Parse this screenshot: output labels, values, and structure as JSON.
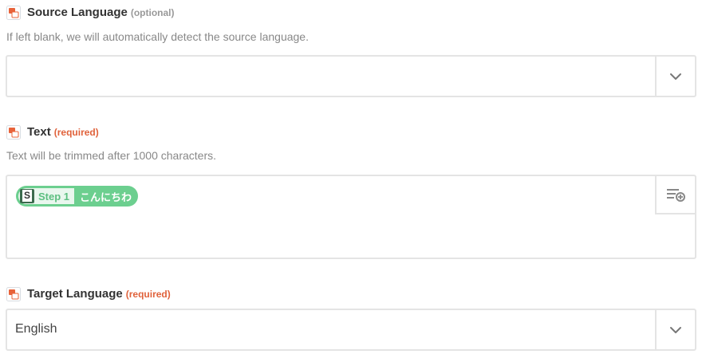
{
  "fields": {
    "source_language": {
      "label": "Source Language",
      "tag": "(optional)",
      "help": "If left blank, we will automatically detect the source language.",
      "value": ""
    },
    "text": {
      "label": "Text",
      "tag": "(required)",
      "help": "Text will be trimmed after 1000 characters.",
      "token": {
        "step_label": "Step 1",
        "value": "こんにちわ"
      }
    },
    "target_language": {
      "label": "Target Language",
      "tag": "(required)",
      "value": "English"
    }
  },
  "icons": {
    "field": "translate-app-icon",
    "dropdown": "chevron-down-icon",
    "insert": "insert-field-icon",
    "step": "s-app-icon"
  },
  "colors": {
    "required": "#e0623b",
    "optional": "#999999",
    "token_bg": "#6ccf8f",
    "border": "#e4e4e4"
  }
}
